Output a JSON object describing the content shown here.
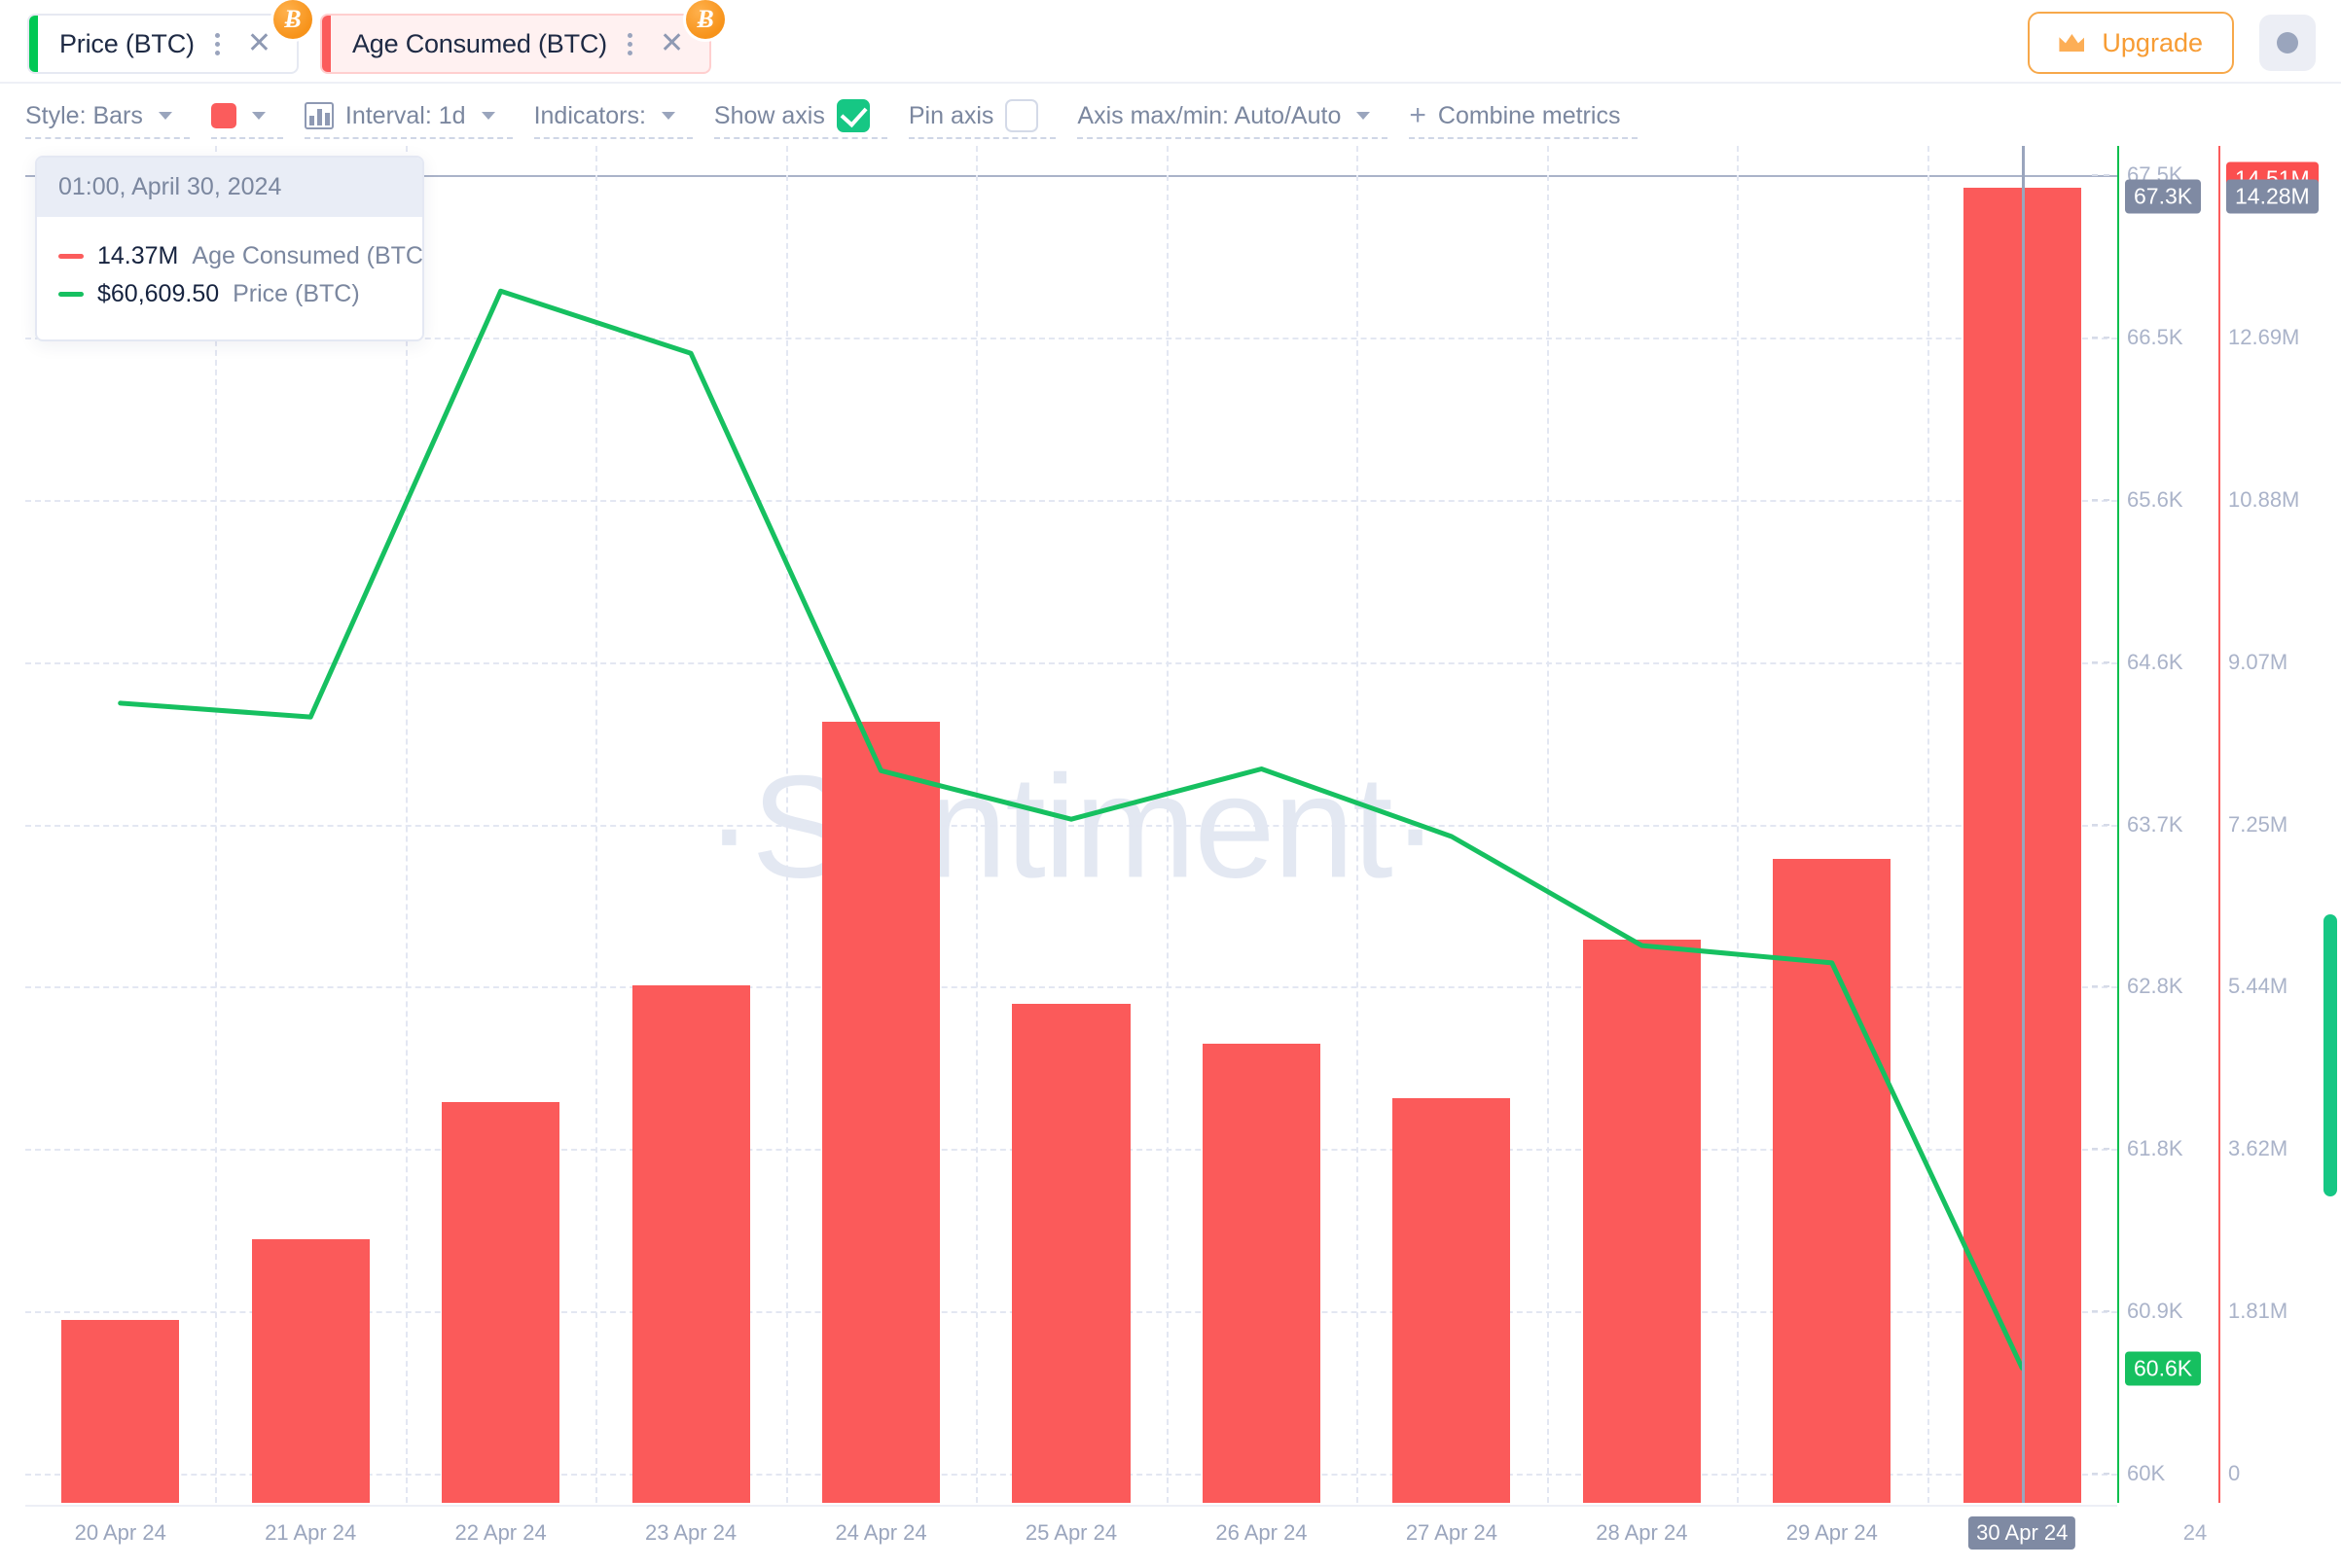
{
  "tabs": [
    {
      "label": "Price (BTC)",
      "accent": "#00c853",
      "badge": "Ƀ",
      "state": "inactive"
    },
    {
      "label": "Age Consumed (BTC)",
      "accent": "#fb5c5c",
      "badge": "Ƀ",
      "state": "active"
    }
  ],
  "header": {
    "upgrade_label": "Upgrade",
    "crown_icon": "crown-icon",
    "avatar_icon": "avatar-icon"
  },
  "controls": {
    "style": "Style: Bars",
    "color_swatch": "#fb5c5c",
    "interval": "Interval: 1d",
    "indicators": "Indicators:",
    "show_axis": "Show axis",
    "show_axis_checked": true,
    "pin_axis": "Pin axis",
    "pin_axis_checked": false,
    "axis_maxmin": "Axis max/min: Auto/Auto",
    "combine_metrics": "Combine metrics"
  },
  "tooltip": {
    "timestamp": "01:00, April 30, 2024",
    "rows": [
      {
        "value": "14.37M",
        "name": "Age Consumed (BTC)",
        "color": "#fb5c5c"
      },
      {
        "value": "$60,609.50",
        "name": "Price (BTC)",
        "color": "#16c060"
      }
    ]
  },
  "watermark": "·Santiment·",
  "chart_data": {
    "type": "bar",
    "title": "",
    "xlabel": "",
    "ylabel": "",
    "grid": true,
    "legend_position": "tooltip",
    "categories": [
      "20 Apr 24",
      "21 Apr 24",
      "22 Apr 24",
      "23 Apr 24",
      "24 Apr 24",
      "25 Apr 24",
      "26 Apr 24",
      "27 Apr 24",
      "28 Apr 24",
      "29 Apr 24",
      "30 Apr 24"
    ],
    "series": [
      {
        "name": "Age Consumed (BTC)",
        "type": "bar",
        "color": "#fb5a5a",
        "axis": "right",
        "unit": "M",
        "values": [
          1.72,
          2.62,
          4.15,
          5.46,
          8.4,
          5.25,
          4.8,
          4.2,
          5.97,
          6.87,
          14.37
        ]
      },
      {
        "name": "Price (BTC)",
        "type": "line",
        "color": "#16c060",
        "axis": "left",
        "unit": "USD",
        "values": [
          64450,
          64370,
          66830,
          66470,
          64060,
          63780,
          64070,
          63680,
          63050,
          62950,
          60609.5
        ]
      }
    ],
    "left_axis": {
      "name": "Price (BTC)",
      "color": "#0bbf4e",
      "ticks": [
        "67.5K",
        "66.5K",
        "65.6K",
        "64.6K",
        "63.7K",
        "62.8K",
        "61.8K",
        "60.9K",
        "60K"
      ],
      "range": [
        60000,
        67500
      ],
      "markers": [
        {
          "label": "67.3K",
          "style": "grey"
        },
        {
          "label": "60.6K",
          "style": "green"
        }
      ]
    },
    "right_axis": {
      "name": "Age Consumed (BTC)",
      "color": "#fb5c5c",
      "ticks": [
        "14.51M",
        "12.69M",
        "10.88M",
        "9.07M",
        "7.25M",
        "5.44M",
        "3.62M",
        "1.81M",
        "0"
      ],
      "range": [
        0,
        14.51
      ],
      "markers": [
        {
          "label": "14.28M",
          "style": "grey"
        },
        {
          "label": "14.51M",
          "style": "red-overlap"
        }
      ]
    },
    "cursor": {
      "category": "30 Apr 24",
      "label": "30 Apr 24"
    }
  }
}
